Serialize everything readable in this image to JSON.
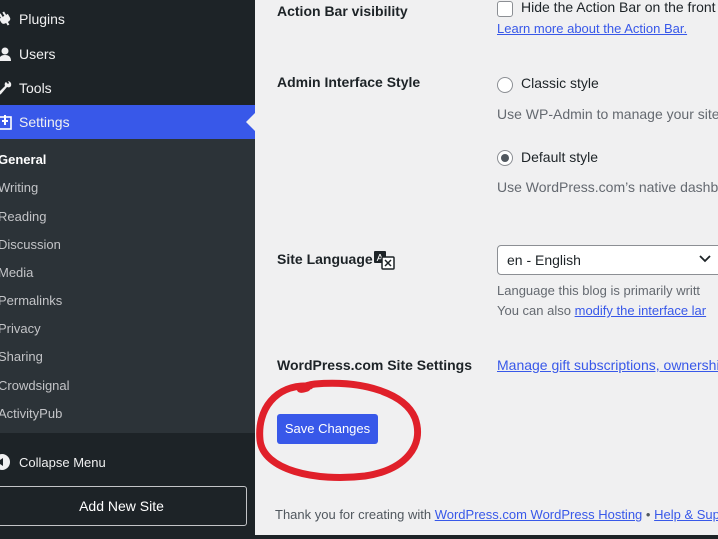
{
  "sidebar": {
    "items": [
      {
        "label": "Plugins",
        "icon": "plugin-icon"
      },
      {
        "label": "Users",
        "icon": "users-icon"
      },
      {
        "label": "Tools",
        "icon": "wrench-icon"
      },
      {
        "label": "Settings",
        "icon": "settings-icon",
        "active": true
      }
    ],
    "submenu": [
      "General",
      "Writing",
      "Reading",
      "Discussion",
      "Media",
      "Permalinks",
      "Privacy",
      "Sharing",
      "Crowdsignal",
      "ActivityPub"
    ],
    "current_submenu": "General",
    "collapse_label": "Collapse Menu",
    "add_site_label": "Add New Site"
  },
  "settings": {
    "action_bar": {
      "label": "Action Bar visibility",
      "checkbox_label": "Hide the Action Bar on the front",
      "link": "Learn more about the Action Bar."
    },
    "admin_style": {
      "label": "Admin Interface Style",
      "option1": "Classic style",
      "option1_desc": "Use WP-Admin to manage your site",
      "option2": "Default style",
      "option2_desc": "Use WordPress.com’s native dashbo",
      "selected": "Default style"
    },
    "site_language": {
      "label": "Site Language",
      "icon": "translate-icon",
      "value": "en - English",
      "desc1": "Language this blog is primarily writt",
      "desc2_prefix": "You can also",
      "desc2_link": "modify the interface lar"
    },
    "wpcom": {
      "label": "WordPress.com Site Settings",
      "link": "Manage gift subscriptions, ownershi"
    }
  },
  "save_button": "Save Changes",
  "footer": {
    "prefix": "Thank you for creating with",
    "link1": "WordPress.com WordPress Hosting",
    "separator": "•",
    "link2": "Help & Supp"
  },
  "colors": {
    "sidebar_bg": "#1d2327",
    "submenu_bg": "#2c3338",
    "accent": "#3858e9",
    "annotation": "#e0202a"
  }
}
